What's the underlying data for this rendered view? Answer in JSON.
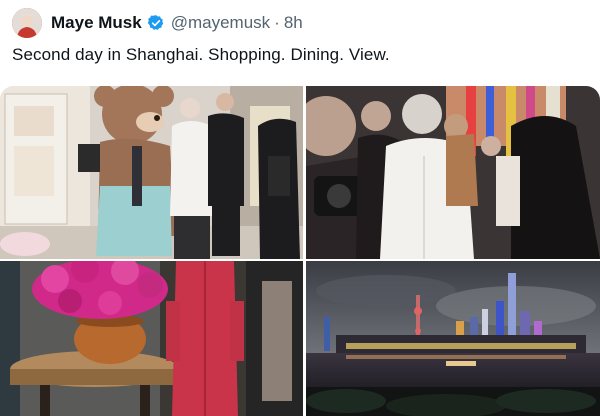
{
  "tweet": {
    "author_name": "Maye Musk",
    "handle": "@mayemusk",
    "separator": "·",
    "time": "8h",
    "text": "Second day in Shanghai. Shopping. Dining. View."
  },
  "icons": {
    "verified": "verified-badge-icon",
    "avatar": "profile-avatar"
  },
  "colors": {
    "verified_blue": "#1d9bf0",
    "secondary_text": "#536471",
    "primary_text": "#0f1419"
  },
  "media": [
    {
      "label": "photo-shopping-teddy-bear"
    },
    {
      "label": "photo-crowd-shopping"
    },
    {
      "label": "photo-dining-flowers"
    },
    {
      "label": "photo-shanghai-skyline-view"
    }
  ]
}
